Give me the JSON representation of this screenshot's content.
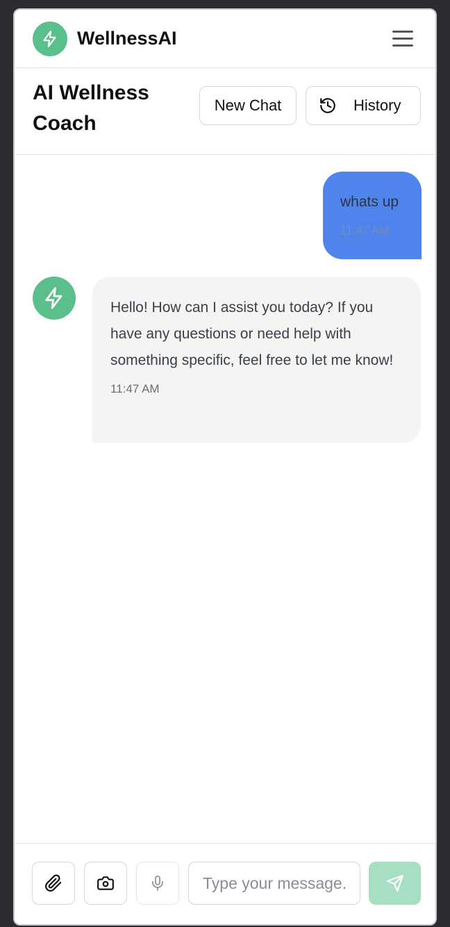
{
  "app": {
    "brand": "WellnessAI",
    "logo_icon": "zap-icon",
    "menu_icon": "hamburger-menu-icon"
  },
  "header": {
    "title": "AI Wellness Coach",
    "new_chat_label": "New Chat",
    "history_label": "History",
    "history_icon": "history-icon"
  },
  "messages": [
    {
      "role": "user",
      "text": "whats up",
      "time": "11:47 AM"
    },
    {
      "role": "assistant",
      "text": "Hello! How can I assist you today? If you have any questions or need help with something specific, feel free to let me know!",
      "time": "11:47 AM"
    }
  ],
  "composer": {
    "placeholder": "Type your message...",
    "value": "",
    "attach_icon": "paperclip-icon",
    "camera_icon": "camera-icon",
    "mic_icon": "microphone-icon",
    "send_icon": "send-icon"
  },
  "colors": {
    "brand_green": "#5bbf8c",
    "user_bubble": "#4f84ec",
    "assistant_bubble": "#f4f4f3",
    "send_disabled": "#a7dfc2"
  }
}
